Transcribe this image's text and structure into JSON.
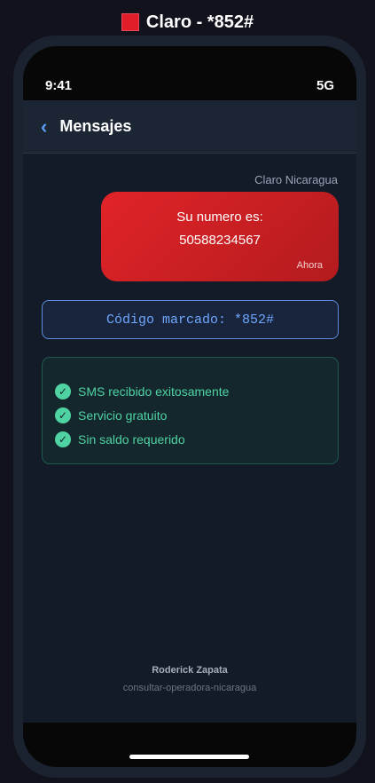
{
  "header": {
    "flag_color": "#e11d2a",
    "title": "Claro - *852#"
  },
  "status_bar": {
    "time": "9:41",
    "network": "5G"
  },
  "nav": {
    "back_icon": "chevron-left-icon",
    "title": "Mensajes"
  },
  "message": {
    "sender": "Claro Nicaragua",
    "line1": "Su numero es:",
    "line2": "50588234567",
    "time": "Ahora",
    "bubble_color": "#e12428"
  },
  "code": {
    "text": "Código marcado: *852#"
  },
  "status_list": [
    {
      "icon": "check-circle-icon",
      "label": "SMS recibido exitosamente"
    },
    {
      "icon": "check-circle-icon",
      "label": "Servicio gratuito"
    },
    {
      "icon": "check-circle-icon",
      "label": "Sin saldo requerido"
    }
  ],
  "footer": {
    "name": "Roderick Zapata",
    "slug": "consultar-operadora-nicaragua"
  }
}
